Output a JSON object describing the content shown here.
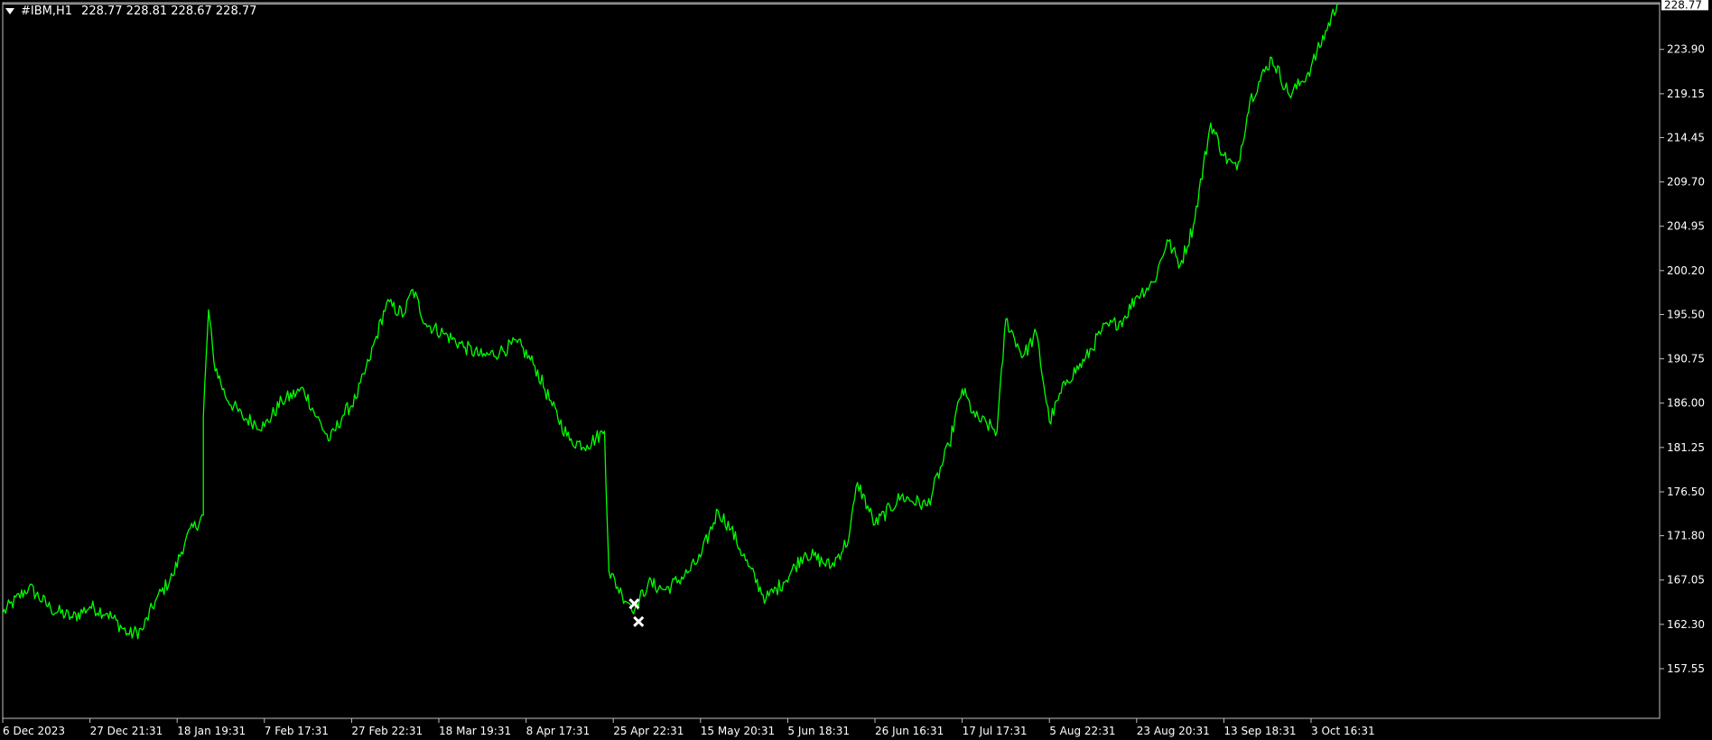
{
  "header": {
    "symbol": "#IBM,H1",
    "ohlc": "228.77 228.81 228.67 228.77",
    "menu_icon": "triangle-down-icon"
  },
  "colors": {
    "background": "#000000",
    "price_line": "#00ff00",
    "axis": "#c0c0c0",
    "text": "#ffffff",
    "current_label_bg": "#ffffff",
    "current_label_text": "#000000",
    "trade_marker": "#ffffff"
  },
  "chart_data": {
    "type": "line",
    "title": "#IBM,H1",
    "current_price": 228.77,
    "ylim": [
      155.0,
      230.5
    ],
    "y_ticks": [
      "223.90",
      "219.15",
      "214.45",
      "209.70",
      "204.95",
      "200.20",
      "195.50",
      "190.75",
      "186.00",
      "181.25",
      "176.50",
      "171.80",
      "167.05",
      "162.30",
      "157.55"
    ],
    "x_ticks": [
      "6 Dec 2023",
      "27 Dec 21:31",
      "18 Jan 19:31",
      "7 Feb 17:31",
      "27 Feb 22:31",
      "18 Mar 19:31",
      "8 Apr 17:31",
      "25 Apr 22:31",
      "15 May 20:31",
      "5 Jun 18:31",
      "26 Jun 16:31",
      "17 Jul 17:31",
      "5 Aug 22:31",
      "23 Aug 20:31",
      "13 Sep 18:31",
      "3 Oct 16:31"
    ],
    "x_tick_index": [
      0,
      1,
      2,
      3,
      4,
      5,
      6,
      7,
      8,
      9,
      10,
      11,
      12,
      13,
      14,
      15
    ],
    "series": [
      {
        "values": [
          {
            "x": 0.0,
            "y": 163.5
          },
          {
            "x": 0.3,
            "y": 166.3
          },
          {
            "x": 0.55,
            "y": 164.0
          },
          {
            "x": 0.8,
            "y": 163.0
          },
          {
            "x": 1.0,
            "y": 164.2
          },
          {
            "x": 1.2,
            "y": 163.5
          },
          {
            "x": 1.45,
            "y": 161.2
          },
          {
            "x": 1.6,
            "y": 161.7
          },
          {
            "x": 1.75,
            "y": 164.8
          },
          {
            "x": 1.95,
            "y": 167.5
          },
          {
            "x": 2.1,
            "y": 171.5
          },
          {
            "x": 2.3,
            "y": 174.0
          },
          {
            "x": 2.3,
            "y": 184.5
          },
          {
            "x": 2.36,
            "y": 196.0
          },
          {
            "x": 2.42,
            "y": 190.5
          },
          {
            "x": 2.55,
            "y": 186.8
          },
          {
            "x": 2.75,
            "y": 184.5
          },
          {
            "x": 3.0,
            "y": 183.5
          },
          {
            "x": 3.2,
            "y": 186.2
          },
          {
            "x": 3.45,
            "y": 187.5
          },
          {
            "x": 3.6,
            "y": 184.5
          },
          {
            "x": 3.75,
            "y": 182.0
          },
          {
            "x": 3.9,
            "y": 184.7
          },
          {
            "x": 4.05,
            "y": 186.5
          },
          {
            "x": 4.2,
            "y": 190.5
          },
          {
            "x": 4.4,
            "y": 196.7
          },
          {
            "x": 4.6,
            "y": 195.5
          },
          {
            "x": 4.7,
            "y": 198.2
          },
          {
            "x": 4.85,
            "y": 194.5
          },
          {
            "x": 5.05,
            "y": 193.5
          },
          {
            "x": 5.3,
            "y": 192.0
          },
          {
            "x": 5.5,
            "y": 191.0
          },
          {
            "x": 5.7,
            "y": 191.5
          },
          {
            "x": 5.9,
            "y": 192.5
          },
          {
            "x": 6.1,
            "y": 190.0
          },
          {
            "x": 6.3,
            "y": 185.7
          },
          {
            "x": 6.5,
            "y": 182.0
          },
          {
            "x": 6.7,
            "y": 181.5
          },
          {
            "x": 6.9,
            "y": 183.0
          },
          {
            "x": 6.95,
            "y": 168.0
          },
          {
            "x": 7.1,
            "y": 165.5
          },
          {
            "x": 7.25,
            "y": 164.0
          },
          {
            "x": 7.4,
            "y": 166.7
          },
          {
            "x": 7.6,
            "y": 166.0
          },
          {
            "x": 7.85,
            "y": 167.8
          },
          {
            "x": 8.0,
            "y": 169.5
          },
          {
            "x": 8.2,
            "y": 174.5
          },
          {
            "x": 8.35,
            "y": 172.5
          },
          {
            "x": 8.55,
            "y": 168.5
          },
          {
            "x": 8.75,
            "y": 165.0
          },
          {
            "x": 8.95,
            "y": 166.8
          },
          {
            "x": 9.2,
            "y": 170.0
          },
          {
            "x": 9.5,
            "y": 168.5
          },
          {
            "x": 9.7,
            "y": 171.5
          },
          {
            "x": 9.8,
            "y": 177.5
          },
          {
            "x": 10.0,
            "y": 173.0
          },
          {
            "x": 10.3,
            "y": 176.0
          },
          {
            "x": 10.6,
            "y": 175.0
          },
          {
            "x": 10.85,
            "y": 181.5
          },
          {
            "x": 11.0,
            "y": 187.5
          },
          {
            "x": 11.15,
            "y": 184.5
          },
          {
            "x": 11.4,
            "y": 183.0
          },
          {
            "x": 11.5,
            "y": 195.0
          },
          {
            "x": 11.7,
            "y": 191.0
          },
          {
            "x": 11.85,
            "y": 193.5
          },
          {
            "x": 12.0,
            "y": 184.0
          },
          {
            "x": 12.2,
            "y": 188.5
          },
          {
            "x": 12.4,
            "y": 190.5
          },
          {
            "x": 12.6,
            "y": 193.8
          },
          {
            "x": 12.85,
            "y": 195.0
          },
          {
            "x": 13.0,
            "y": 197.5
          },
          {
            "x": 13.2,
            "y": 199.0
          },
          {
            "x": 13.35,
            "y": 203.5
          },
          {
            "x": 13.5,
            "y": 200.8
          },
          {
            "x": 13.65,
            "y": 205.0
          },
          {
            "x": 13.85,
            "y": 216.0
          },
          {
            "x": 14.0,
            "y": 212.5
          },
          {
            "x": 14.15,
            "y": 211.0
          },
          {
            "x": 14.3,
            "y": 218.5
          },
          {
            "x": 14.55,
            "y": 223.0
          },
          {
            "x": 14.75,
            "y": 219.0
          },
          {
            "x": 14.9,
            "y": 220.5
          },
          {
            "x": 15.0,
            "y": 222.0
          },
          {
            "x": 15.3,
            "y": 228.77
          }
        ]
      }
    ],
    "trade_markers": [
      {
        "x": 7.24,
        "y": 164.5
      },
      {
        "x": 7.29,
        "y": 162.6
      }
    ]
  }
}
